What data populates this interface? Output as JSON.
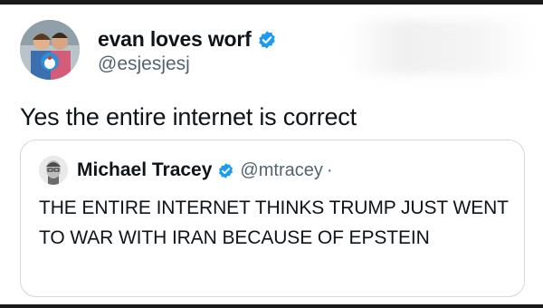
{
  "tweet": {
    "display_name": "evan loves worf",
    "handle": "@esjesjesj",
    "text": "Yes the entire internet is correct",
    "verified_icon": "verified-badge-icon"
  },
  "quoted_tweet": {
    "display_name": "Michael Tracey",
    "handle": "@mtracey",
    "separator": "·",
    "text": "THE ENTIRE INTERNET THINKS TRUMP JUST WENT TO WAR WITH IRAN BECAUSE OF EPSTEIN",
    "verified_icon": "verified-badge-icon"
  },
  "colors": {
    "verified_blue": "#1d9bf0",
    "text": "#0f1419",
    "secondary_text": "#536471",
    "border": "#cfd9de"
  }
}
